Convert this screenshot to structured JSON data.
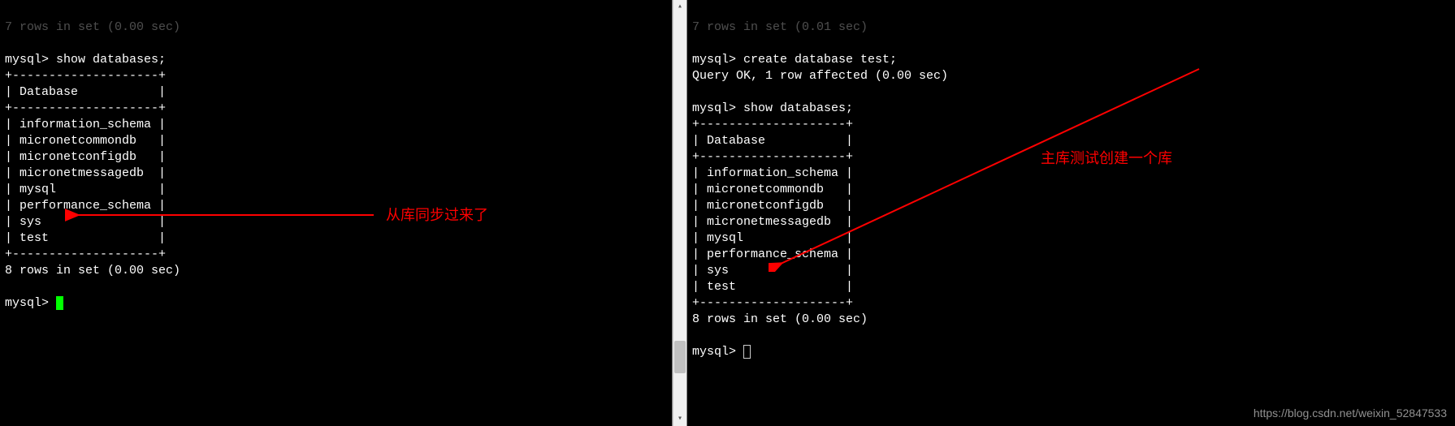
{
  "left": {
    "rows_hint": "7 rows in set (0.00 sec)",
    "prompt1": "mysql> show databases;",
    "sep": "+--------------------+",
    "header": "| Database           |",
    "dbs": [
      "| information_schema |",
      "| micronetcommondb   |",
      "| micronetconfigdb   |",
      "| micronetmessagedb  |",
      "| mysql              |",
      "| performance_schema |",
      "| sys                |",
      "| test               |"
    ],
    "rows": "8 rows in set (0.00 sec)",
    "prompt2": "mysql> ",
    "annotation": "从库同步过来了"
  },
  "right": {
    "rows_hint": "7 rows in set (0.01 sec)",
    "prompt1": "mysql> create database test;",
    "result1": "Query OK, 1 row affected (0.00 sec)",
    "prompt2": "mysql> show databases;",
    "sep": "+--------------------+",
    "header": "| Database           |",
    "dbs": [
      "| information_schema |",
      "| micronetcommondb   |",
      "| micronetconfigdb   |",
      "| micronetmessagedb  |",
      "| mysql              |",
      "| performance_schema |",
      "| sys                |",
      "| test               |"
    ],
    "rows": "8 rows in set (0.00 sec)",
    "prompt3": "mysql> ",
    "annotation": "主库测试创建一个库"
  },
  "watermark": "https://blog.csdn.net/weixin_52847533"
}
